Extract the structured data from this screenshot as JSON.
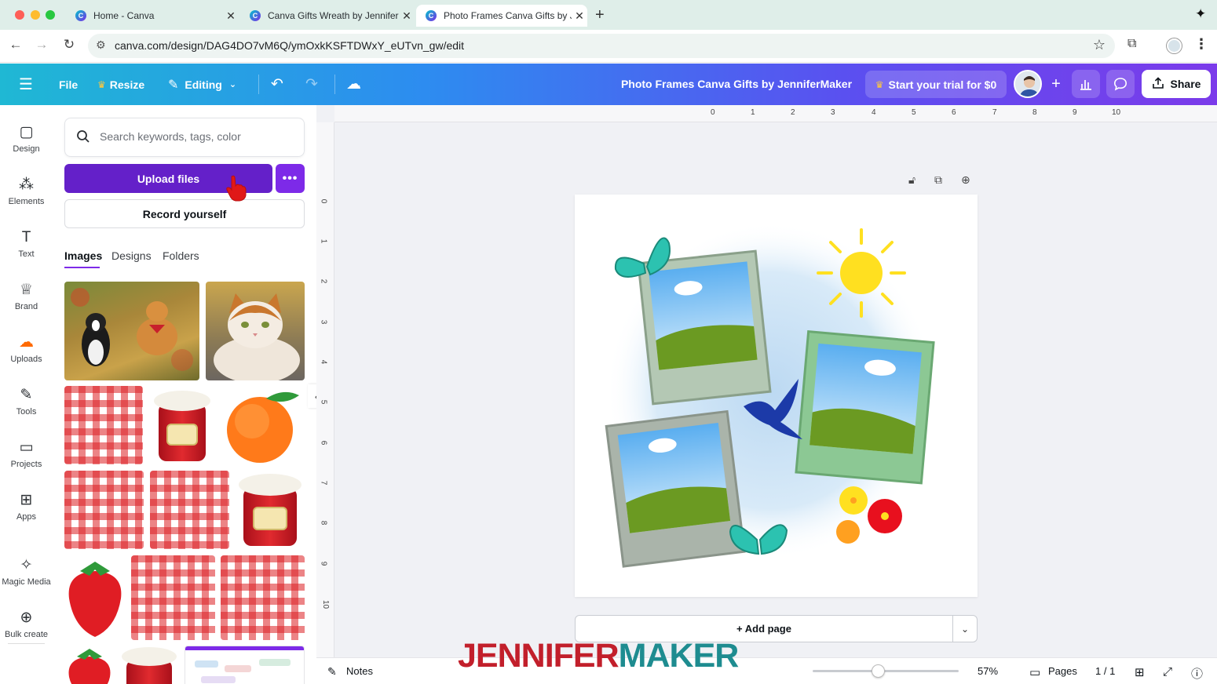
{
  "browser": {
    "tabs": [
      {
        "title": "Home - Canva",
        "active": false
      },
      {
        "title": "Canva Gifts Wreath by JenniferMaker",
        "active": false
      },
      {
        "title": "Photo Frames Canva Gifts by JenniferMaker",
        "active": true
      }
    ],
    "url": "canva.com/design/DAG4DO7vM6Q/ymOxkKSFTDWxY_eUTvn_gw/edit"
  },
  "header": {
    "menu_icon": "hamburger-icon",
    "file_label": "File",
    "resize_label": "Resize",
    "editing_label": "Editing",
    "doc_title": "Photo Frames Canva Gifts by JenniferMaker",
    "trial_label": "Start your trial for $0",
    "share_label": "Share",
    "colors": {
      "gradient_start": "#1fb8d4",
      "gradient_end": "#7b3bea"
    }
  },
  "rail": {
    "items": [
      {
        "label": "Design",
        "icon": "design-icon"
      },
      {
        "label": "Elements",
        "icon": "elements-icon"
      },
      {
        "label": "Text",
        "icon": "text-icon"
      },
      {
        "label": "Brand",
        "icon": "brand-icon"
      },
      {
        "label": "Uploads",
        "icon": "uploads-icon",
        "active": true
      },
      {
        "label": "Tools",
        "icon": "tools-icon"
      },
      {
        "label": "Projects",
        "icon": "projects-icon"
      },
      {
        "label": "Apps",
        "icon": "apps-icon"
      },
      {
        "label": "Magic Media",
        "icon": "magic-media-icon"
      },
      {
        "label": "Bulk create",
        "icon": "bulk-create-icon"
      }
    ]
  },
  "panel": {
    "search_placeholder": "Search keywords, tags, color",
    "upload_label": "Upload files",
    "more_label": "•••",
    "record_label": "Record yourself",
    "tabs": [
      {
        "label": "Images",
        "active": true
      },
      {
        "label": "Designs",
        "active": false
      },
      {
        "label": "Folders",
        "active": false
      }
    ],
    "accent_color": "#7d2ae8"
  },
  "canvas": {
    "ruler_x": [
      "0",
      "1",
      "2",
      "3",
      "4",
      "5",
      "6",
      "7",
      "8",
      "9",
      "10"
    ],
    "ruler_y": [
      "0",
      "1",
      "2",
      "3",
      "4",
      "5",
      "6",
      "7",
      "8",
      "9",
      "10"
    ],
    "add_page_label": "+ Add page"
  },
  "footer": {
    "notes_label": "Notes",
    "zoom_value": "57%",
    "zoom_fraction": 0.45,
    "pages_label": "Pages",
    "page_count": "1 / 1"
  },
  "watermark": {
    "part1": "JENNIFER",
    "part2": "MAKER"
  }
}
